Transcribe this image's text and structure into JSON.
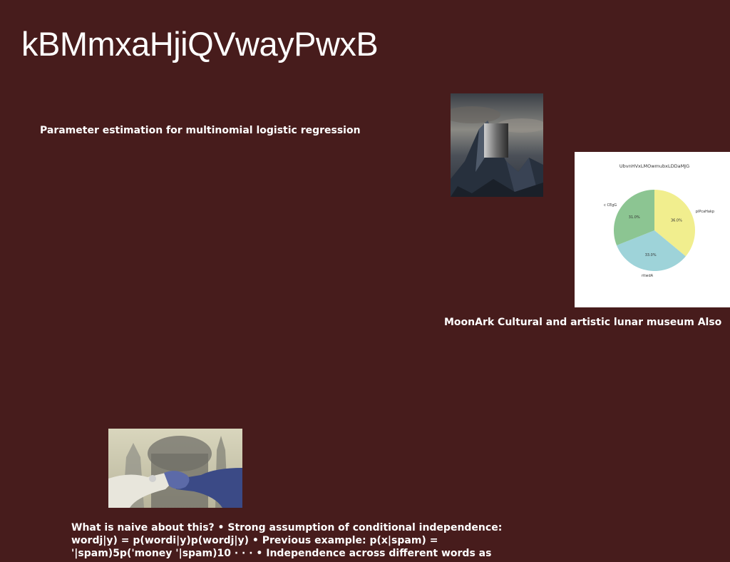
{
  "title": "kBMmxaHjiQVwayPwxB",
  "subtitle": "Parameter estimation for multinomial logistic regression",
  "caption": "MoonArk Cultural and artistic lunar museum Also",
  "body_lines": [
    "What is naive about this? • Strong assumption of conditional independence:",
    "wordj|y) = p(wordi|y)p(wordj|y) • Previous example: p(x|spam) =",
    "'|spam)5p('money '|spam)10 · · · • Independence across different words as"
  ],
  "images": {
    "mountain": "mountain-monolith-photo",
    "hands": "holding-hands-photo"
  },
  "chart_data": {
    "type": "pie",
    "title": "UbvnHVxLMOwmubxLDDaMJG",
    "slices": [
      {
        "label": "plPcaHakp",
        "value": 36.0,
        "pct_label": "36.0%",
        "color": "#f1ee8e"
      },
      {
        "label": "ritwdA",
        "value": 33.0,
        "pct_label": "33.0%",
        "color": "#9ed3d9"
      },
      {
        "label": "c CEgG",
        "value": 31.0,
        "pct_label": "31.0%",
        "color": "#8cc592"
      }
    ],
    "start_angle": 90,
    "direction": "clockwise"
  },
  "colors": {
    "background": "#471c1c",
    "text": "#ffffff"
  }
}
